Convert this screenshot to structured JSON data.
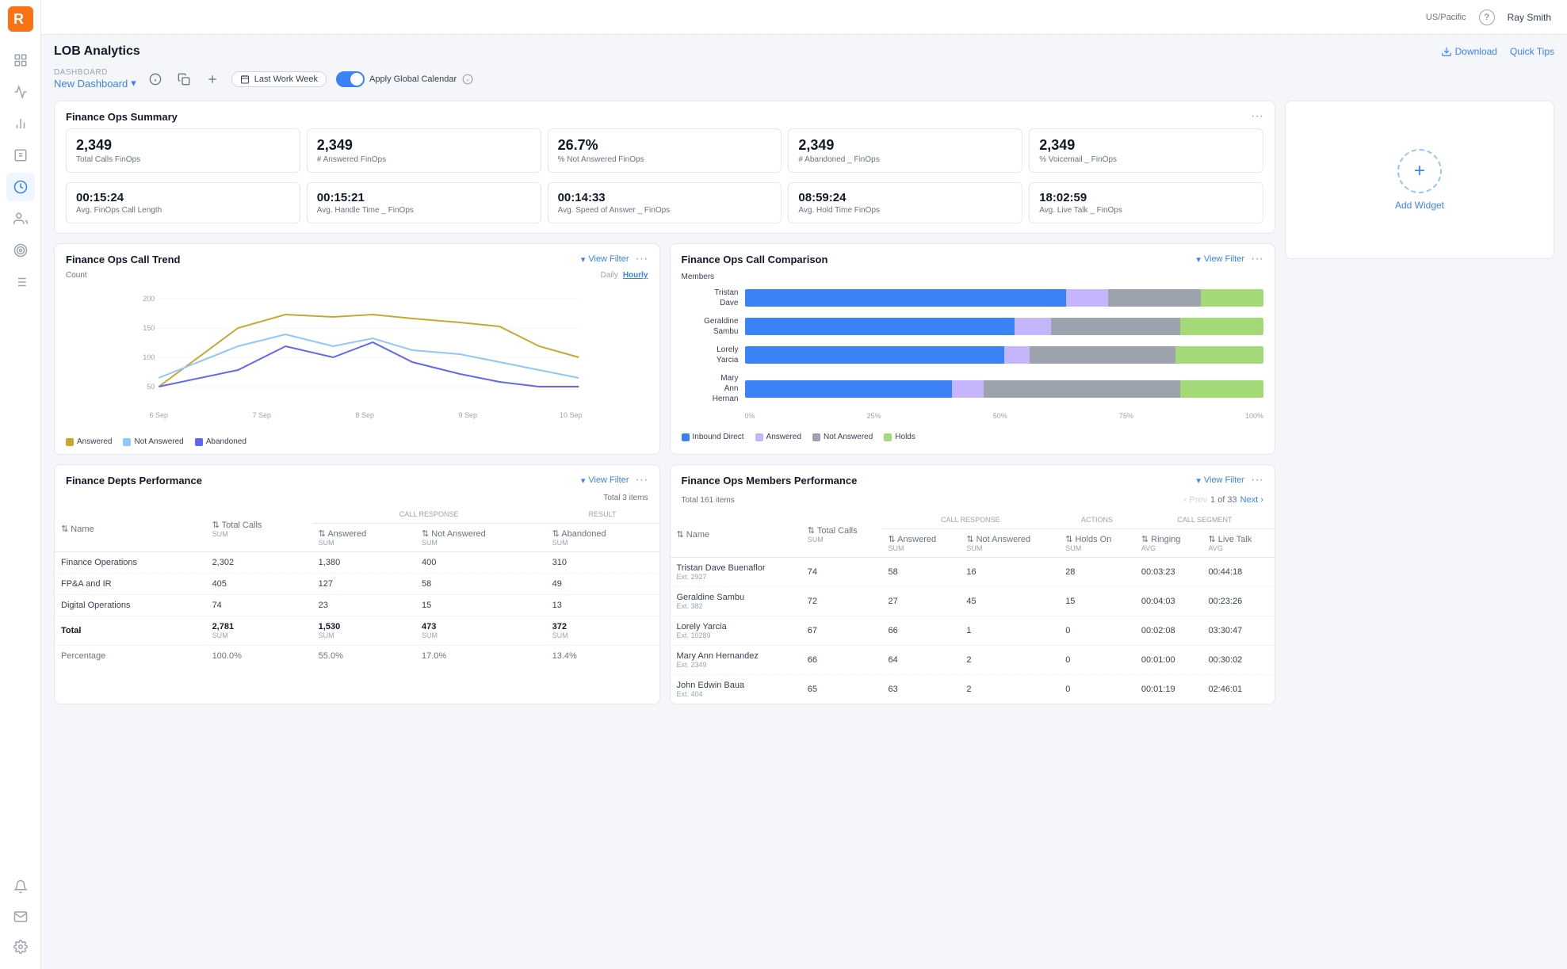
{
  "topbar": {
    "region": "US/Pacific",
    "help_label": "?",
    "user": "Ray Smith",
    "download_label": "Download",
    "quick_tips_label": "Quick Tips"
  },
  "page": {
    "title": "LOB Analytics"
  },
  "dashboard": {
    "breadcrumb_label": "DASHBOARD",
    "name": "New Dashboard",
    "date_filter": "Last Work Week",
    "apply_calendar": "Apply Global Calendar",
    "add_widget_label": "Add Widget"
  },
  "summary": {
    "title": "Finance Ops Summary",
    "stats_row1": [
      {
        "value": "2,349",
        "label": "Total Calls FinOps"
      },
      {
        "value": "2,349",
        "label": "# Answered FinOps"
      },
      {
        "value": "26.7%",
        "label": "% Not Answered FinOps"
      },
      {
        "value": "2,349",
        "label": "# Abandoned _ FinOps"
      },
      {
        "value": "2,349",
        "label": "% Voicemail _ FinOps"
      }
    ],
    "stats_row2": [
      {
        "value": "00:15:24",
        "label": "Avg. FinOps Call Length"
      },
      {
        "value": "00:15:21",
        "label": "Avg. Handle Time _ FinOps"
      },
      {
        "value": "00:14:33",
        "label": "Avg. Speed of Answer _ FinOps"
      },
      {
        "value": "08:59:24",
        "label": "Avg. Hold Time FinOps"
      },
      {
        "value": "18:02:59",
        "label": "Avg. Live Talk _ FinOps"
      }
    ]
  },
  "call_trend": {
    "title": "Finance Ops Call Trend",
    "view_filter": "View Filter",
    "tab_daily": "Daily",
    "tab_hourly": "Hourly",
    "y_label": "Count",
    "y_values": [
      "200",
      "150",
      "100",
      "50"
    ],
    "x_labels": [
      "6 Sep",
      "7 Sep",
      "8 Sep",
      "9 Sep",
      "10 Sep"
    ],
    "legend": [
      {
        "color": "#c8a832",
        "label": "Answered"
      },
      {
        "color": "#93c5fd",
        "label": "Not Answered"
      },
      {
        "color": "#6366f1",
        "label": "Abandoned"
      }
    ]
  },
  "call_comparison": {
    "title": "Finance Ops Call Comparison",
    "view_filter": "View Filter",
    "y_label": "Members",
    "members": [
      {
        "name": "Tristan\nDave",
        "blue": 62,
        "lavender": 8,
        "gray": 18,
        "green": 12
      },
      {
        "name": "Geraldine\nSambu",
        "blue": 52,
        "lavender": 7,
        "gray": 25,
        "green": 16
      },
      {
        "name": "Lorely\nYarcia",
        "blue": 50,
        "lavender": 5,
        "gray": 28,
        "green": 17
      },
      {
        "name": "Mary\nAnn\nHernan",
        "blue": 40,
        "lavender": 6,
        "gray": 38,
        "green": 16
      }
    ],
    "x_labels": [
      "0%",
      "25%",
      "50%",
      "75%",
      "100%"
    ],
    "legend": [
      {
        "color": "#3b82f6",
        "label": "Inbound Direct"
      },
      {
        "color": "#c4b5fd",
        "label": "Answered"
      },
      {
        "color": "#9ca3af",
        "label": "Not Answered"
      },
      {
        "color": "#a3d977",
        "label": "Holds"
      }
    ]
  },
  "depts_performance": {
    "title": "Finance Depts Performance",
    "view_filter": "View Filter",
    "total_items": "Total 3 items",
    "headers": {
      "name": "Name",
      "total_calls": "Total Calls",
      "call_response": "CALL RESPONSE",
      "answered": "Answered",
      "not_answered": "Not Answered",
      "result": "RESULT",
      "abandoned": "Abandoned"
    },
    "sub_labels": {
      "sum": "SUM"
    },
    "rows": [
      {
        "name": "Finance Operations",
        "total_calls": "2,302",
        "answered": "1,380",
        "not_answered": "400",
        "abandoned": "310"
      },
      {
        "name": "FP&A and IR",
        "total_calls": "405",
        "answered": "127",
        "not_answered": "58",
        "abandoned": "49"
      },
      {
        "name": "Digital Operations",
        "total_calls": "74",
        "answered": "23",
        "not_answered": "15",
        "abandoned": "13"
      }
    ],
    "total_row": {
      "label": "Total",
      "total_calls": "2,781",
      "answered": "1,530",
      "not_answered": "473",
      "abandoned": "372"
    },
    "pct_row": {
      "label": "Percentage",
      "total_calls": "100.0%",
      "answered": "55.0%",
      "not_answered": "17.0%",
      "abandoned": "13.4%"
    }
  },
  "members_performance": {
    "title": "Finance Ops Members Performance",
    "view_filter": "View Filter",
    "total_items": "Total 161 items",
    "pagination": {
      "prev": "‹ Prev",
      "current": "1 of 33",
      "next": "Next ›"
    },
    "headers": {
      "name": "Name",
      "total_calls": "Total Calls",
      "call_response": "CALL RESPONSE",
      "answered": "Answered",
      "not_answered": "Not Answered",
      "actions": "ACTIONS",
      "holds_on": "Holds On",
      "call_segment": "CALL SEGMENT",
      "ringing": "Ringing",
      "live_talk": "Live Talk"
    },
    "sub_labels": {
      "sum": "SUM",
      "avg": "AVG"
    },
    "rows": [
      {
        "name": "Tristan Dave Buenaflor",
        "ext": "Ext. 2927",
        "total_calls": "74",
        "answered": "58",
        "not_answered": "16",
        "holds_on": "28",
        "ringing": "00:03:23",
        "live_talk": "00:44:18"
      },
      {
        "name": "Geraldine Sambu",
        "ext": "Ext. 382",
        "total_calls": "72",
        "answered": "27",
        "not_answered": "45",
        "holds_on": "15",
        "ringing": "00:04:03",
        "live_talk": "00:23:26"
      },
      {
        "name": "Lorely Yarcia",
        "ext": "Ext. 10289",
        "total_calls": "67",
        "answered": "66",
        "not_answered": "1",
        "holds_on": "0",
        "ringing": "00:02:08",
        "live_talk": "03:30:47"
      },
      {
        "name": "Mary Ann Hernandez",
        "ext": "Ext. 2349",
        "total_calls": "66",
        "answered": "64",
        "not_answered": "2",
        "holds_on": "0",
        "ringing": "00:01:00",
        "live_talk": "00:30:02"
      },
      {
        "name": "John Edwin Baua",
        "ext": "Ext. 404",
        "total_calls": "65",
        "answered": "63",
        "not_answered": "2",
        "holds_on": "0",
        "ringing": "00:01:19",
        "live_talk": "02:46:01"
      }
    ]
  },
  "icons": {
    "home": "⊞",
    "chart_bar": "▦",
    "chart_line": "📈",
    "group": "👥",
    "target": "◎",
    "list": "≡",
    "bell": "🔔",
    "email": "✉",
    "settings": "⚙",
    "download_arrow": "↓",
    "chevron_down": "▾",
    "sort": "⇅",
    "filter_icon": "▾"
  }
}
